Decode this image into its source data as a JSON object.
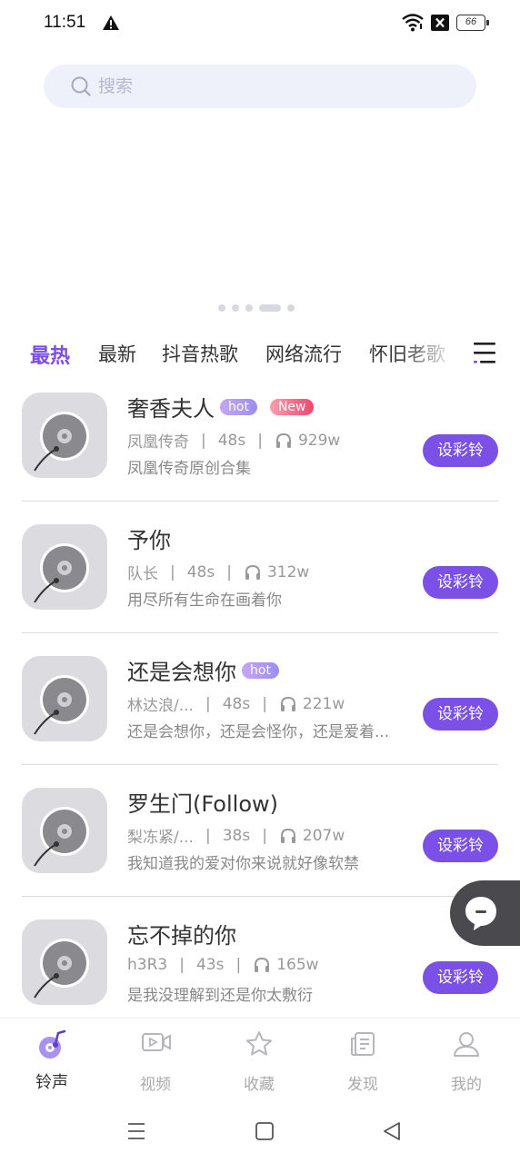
{
  "status_bar": {
    "time": "11:51",
    "battery": "66"
  },
  "search": {
    "placeholder": "搜索"
  },
  "banner": {
    "dot_count": 5,
    "active_index": 3
  },
  "tabs": [
    {
      "label": "最热",
      "active": true
    },
    {
      "label": "最新",
      "active": false
    },
    {
      "label": "抖音热歌",
      "active": false
    },
    {
      "label": "网络流行",
      "active": false
    },
    {
      "label": "怀旧老歌",
      "active": false
    }
  ],
  "songs": [
    {
      "title": "奢香夫人",
      "badges": [
        "hot",
        "New"
      ],
      "artist": "凤凰传奇",
      "duration": "48s",
      "plays": "929w",
      "desc": "凤凰传奇原创合集",
      "button": "设彩铃"
    },
    {
      "title": "予你",
      "badges": [],
      "artist": "队长",
      "duration": "48s",
      "plays": "312w",
      "desc": "用尽所有生命在画着你",
      "button": "设彩铃"
    },
    {
      "title": "还是会想你",
      "badges": [
        "hot"
      ],
      "artist": "林达浪/...",
      "duration": "48s",
      "plays": "221w",
      "desc": "还是会想你，还是会怪你，还是爱着...",
      "button": "设彩铃"
    },
    {
      "title": "罗生门(Follow)",
      "badges": [],
      "artist": "梨冻紧/...",
      "duration": "38s",
      "plays": "207w",
      "desc": "我知道我的爱对你来说就好像软禁",
      "button": "设彩铃"
    },
    {
      "title": "忘不掉的你",
      "badges": [],
      "artist": "h3R3",
      "duration": "43s",
      "plays": "165w",
      "desc": "是我没理解到还是你太敷衍",
      "button": "设彩铃"
    }
  ],
  "bottom_nav": [
    {
      "label": "铃声",
      "icon": "ringtone-icon",
      "active": true
    },
    {
      "label": "视频",
      "icon": "video-icon",
      "active": false
    },
    {
      "label": "收藏",
      "icon": "star-icon",
      "active": false
    },
    {
      "label": "发现",
      "icon": "discover-icon",
      "active": false
    },
    {
      "label": "我的",
      "icon": "user-icon",
      "active": false
    }
  ],
  "colors": {
    "accent": "#7a50e6",
    "hot_badge": "#a99af2",
    "new_badge": "#f0466d"
  }
}
